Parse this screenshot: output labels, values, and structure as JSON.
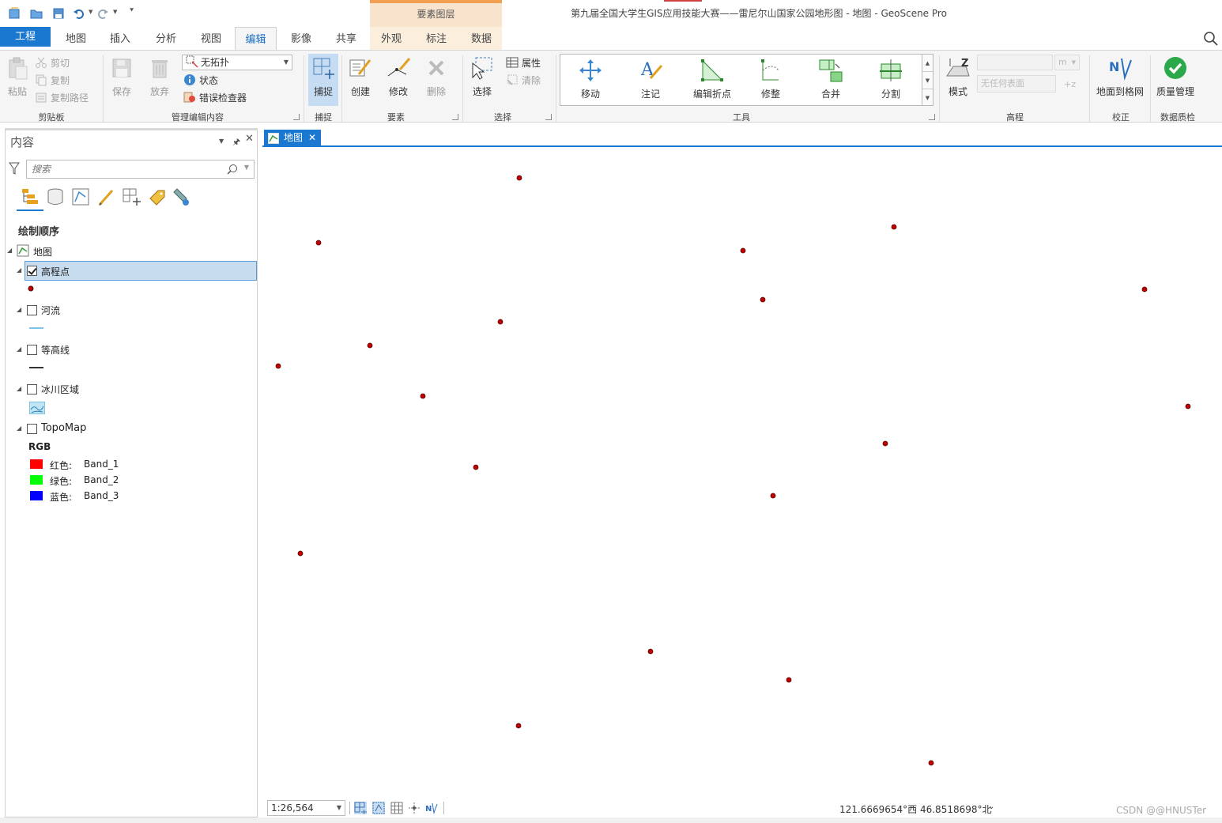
{
  "window": {
    "title": "第九届全国大学生GIS应用技能大赛——雷尼尔山国家公园地形图 - 地图 - GeoScene Pro",
    "context_header": "要素图层"
  },
  "tabs": [
    {
      "label": "工程"
    },
    {
      "label": "地图"
    },
    {
      "label": "插入"
    },
    {
      "label": "分析"
    },
    {
      "label": "视图"
    },
    {
      "label": "编辑"
    },
    {
      "label": "影像"
    },
    {
      "label": "共享"
    },
    {
      "label": "外观"
    },
    {
      "label": "标注"
    },
    {
      "label": "数据"
    }
  ],
  "ribbon": {
    "clipboard": {
      "paste": "粘贴",
      "cut": "剪切",
      "copy": "复制",
      "copy_path": "复制路径",
      "group": "剪贴板"
    },
    "manage": {
      "save": "保存",
      "discard": "放弃",
      "topology": "无拓扑",
      "status": "状态",
      "error_inspector": "错误检查器",
      "group": "管理编辑内容"
    },
    "snapping": {
      "snap": "捕捉",
      "group": "捕捉"
    },
    "features": {
      "create": "创建",
      "modify": "修改",
      "delete": "删除",
      "group": "要素"
    },
    "selection": {
      "select": "选择",
      "attributes": "属性",
      "clear": "清除",
      "group": "选择"
    },
    "tools": {
      "move": "移动",
      "annotate": "注记",
      "edit_vertices": "编辑折点",
      "reshape": "修整",
      "merge": "合并",
      "split": "分割",
      "group": "工具"
    },
    "elevation": {
      "mode": "模式",
      "unit": "m",
      "surface": "无任何表面",
      "group": "高程"
    },
    "correction": {
      "ground_to_grid": "地面到格网",
      "group": "校正"
    },
    "quality": {
      "quality_manage": "质量管理",
      "group": "数据质检"
    }
  },
  "contents": {
    "title": "内容",
    "search_placeholder": "搜索",
    "draw_order": "绘制顺序",
    "map_name": "地图",
    "layers": [
      {
        "name": "高程点",
        "checked": true
      },
      {
        "name": "河流",
        "checked": false
      },
      {
        "name": "等高线",
        "checked": false
      },
      {
        "name": "冰川区域",
        "checked": false
      },
      {
        "name": "TopoMap",
        "checked": false
      }
    ],
    "rgb": {
      "title": "RGB",
      "bands": [
        {
          "channel": "红色:",
          "band": "Band_1",
          "color": "#ff0000"
        },
        {
          "channel": "绿色:",
          "band": "Band_2",
          "color": "#00ff00"
        },
        {
          "channel": "蓝色:",
          "band": "Band_3",
          "color": "#0000ff"
        }
      ]
    }
  },
  "map_view": {
    "tab_label": "地图",
    "tab_close": "✕",
    "point_color": "#c00000",
    "scale": "1:26,564",
    "coordinates": "121.6669654°西 46.8518698°北"
  },
  "watermark": "CSDN @@HNUSTer",
  "colors": {
    "accent": "#1a78d0",
    "selection": "#c8dcf0"
  }
}
